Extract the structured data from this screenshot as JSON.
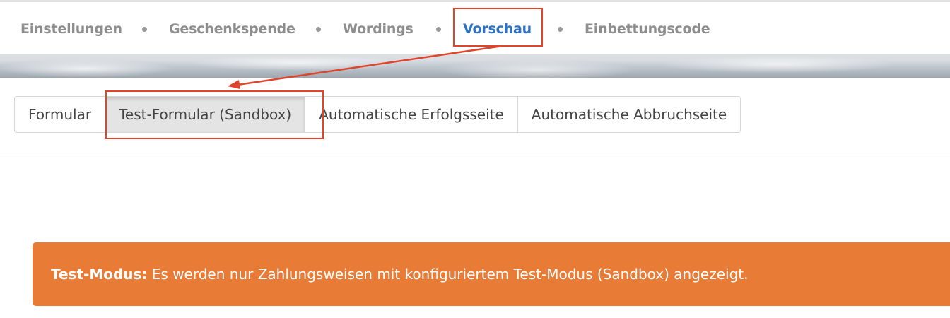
{
  "nav": {
    "items": [
      {
        "label": "Einstellungen",
        "active": false
      },
      {
        "label": "Geschenkspende",
        "active": false
      },
      {
        "label": "Wordings",
        "active": false
      },
      {
        "label": "Vorschau",
        "active": true
      },
      {
        "label": "Einbettungscode",
        "active": false
      }
    ]
  },
  "tabs": {
    "items": [
      {
        "label": "Formular",
        "active": false
      },
      {
        "label": "Test-Formular (Sandbox)",
        "active": true
      },
      {
        "label": "Automatische Erfolgsseite",
        "active": false
      },
      {
        "label": "Automatische Abbruchseite",
        "active": false
      }
    ]
  },
  "alert": {
    "strong": "Test-Modus:",
    "message": " Es werden nur Zahlungsweisen mit konfiguriertem Test-Modus (Sandbox) angezeigt."
  },
  "colors": {
    "nav_active": "#2d72c5",
    "annotation": "#e0452c",
    "alert_bg": "#e87c36"
  }
}
